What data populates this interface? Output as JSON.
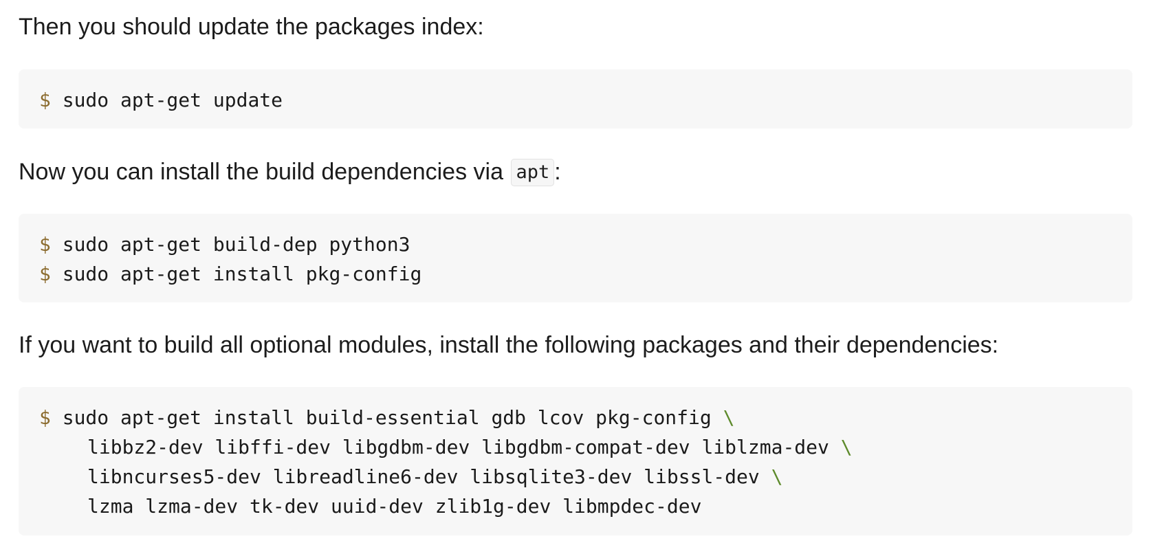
{
  "paragraphs": {
    "update_intro": "Then you should update the packages index:",
    "install_intro_prefix": "Now you can install the build dependencies via ",
    "install_intro_code": "apt",
    "install_intro_suffix": ":",
    "optional_intro": "If you want to build all optional modules, install the following packages and their dependencies:"
  },
  "code_blocks": {
    "update": {
      "prompt": "$",
      "lines": [
        "sudo apt-get update"
      ]
    },
    "build_deps": {
      "prompt": "$",
      "lines": [
        "sudo apt-get build-dep python3",
        "sudo apt-get install pkg-config"
      ]
    },
    "optional": {
      "prompt": "$",
      "continuation": "\\",
      "first_line": "sudo apt-get install build-essential gdb lcov pkg-config",
      "lines": [
        "libbz2-dev libffi-dev libgdbm-dev libgdbm-compat-dev liblzma-dev",
        "libncurses5-dev libreadline6-dev libsqlite3-dev libssl-dev",
        "lzma lzma-dev tk-dev uuid-dev zlib1g-dev libmpdec-dev"
      ]
    }
  },
  "colors": {
    "prompt": "#8b6b2e",
    "continuation": "#5d8a2b",
    "code_background": "#f7f7f7"
  }
}
